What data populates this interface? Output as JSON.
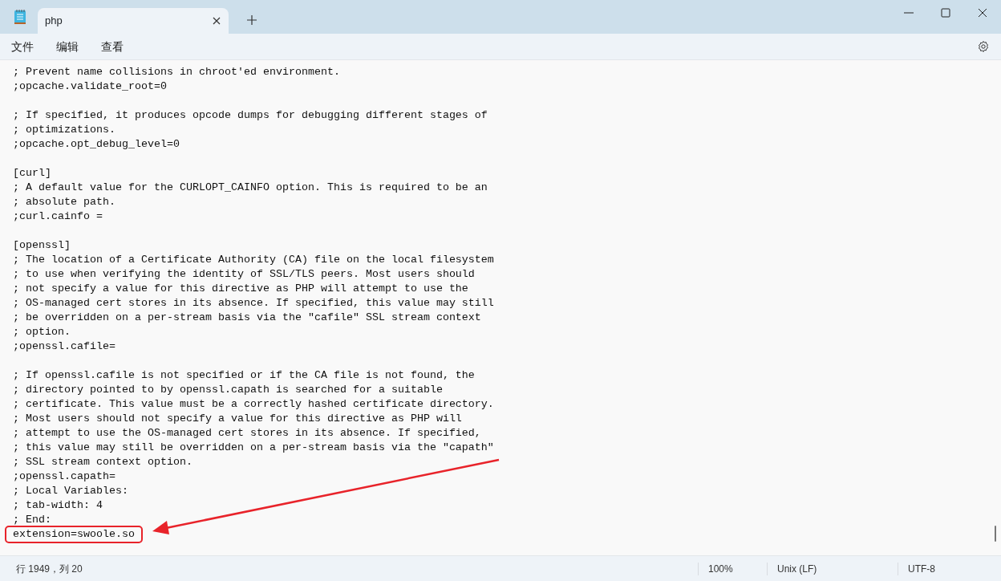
{
  "window": {
    "tab_title": "php"
  },
  "menu": [
    "文件",
    "编辑",
    "查看"
  ],
  "editor": {
    "blocks": [
      [
        "; Prevent name collisions in chroot'ed environment.",
        ";opcache.validate_root=0"
      ],
      [
        "; If specified, it produces opcode dumps for debugging different stages of",
        "; optimizations.",
        ";opcache.opt_debug_level=0"
      ],
      [
        "[curl]",
        "; A default value for the CURLOPT_CAINFO option. This is required to be an",
        "; absolute path.",
        ";curl.cainfo ="
      ],
      [
        "[openssl]",
        "; The location of a Certificate Authority (CA) file on the local filesystem",
        "; to use when verifying the identity of SSL/TLS peers. Most users should",
        "; not specify a value for this directive as PHP will attempt to use the",
        "; OS-managed cert stores in its absence. If specified, this value may still",
        "; be overridden on a per-stream basis via the \"cafile\" SSL stream context",
        "; option.",
        ";openssl.cafile="
      ],
      [
        "; If openssl.cafile is not specified or if the CA file is not found, the",
        "; directory pointed to by openssl.capath is searched for a suitable",
        "; certificate. This value must be a correctly hashed certificate directory.",
        "; Most users should not specify a value for this directive as PHP will",
        "; attempt to use the OS-managed cert stores in its absence. If specified,",
        "; this value may still be overridden on a per-stream basis via the \"capath\"",
        "; SSL stream context option.",
        ";openssl.capath=",
        "; Local Variables:",
        "; tab-width: 4",
        "; End:",
        "extension=swoole.so"
      ]
    ],
    "last_line_highlighted": true
  },
  "status_bar": {
    "position": "行 1949，列 20",
    "zoom": "100%",
    "line_ending": "Unix (LF)",
    "encoding": "UTF-8"
  }
}
